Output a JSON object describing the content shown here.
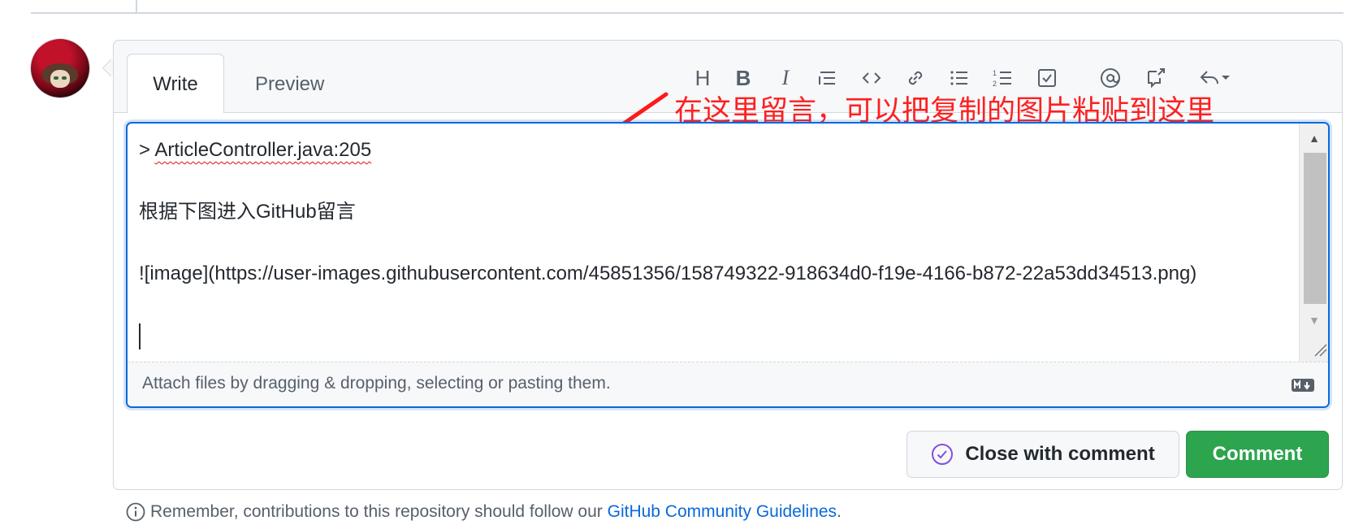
{
  "tabs": {
    "write": "Write",
    "preview": "Preview"
  },
  "toolbar": {
    "heading": "H",
    "bold": "B",
    "italic": "I"
  },
  "annotation": "在这里留言，可以把复制的图片粘贴到这里",
  "editor": {
    "lines": [
      "> ",
      "ArticleController.java:205",
      "根据下图进入GitHub留言",
      "![image](https://user-images.githubusercontent.com/45851356/158749322-918634d0-f19e-4166-b872-22a53dd34513.png)"
    ],
    "attach_hint": "Attach files by dragging & dropping, selecting or pasting them."
  },
  "buttons": {
    "close_with_comment": "Close with comment",
    "comment": "Comment"
  },
  "footer": {
    "text": "Remember, contributions to this repository should follow our ",
    "link": "GitHub Community Guidelines",
    "period": "."
  },
  "colors": {
    "accent": "#0969da",
    "comment_green": "#2da44e",
    "annotation_red": "#ff2020",
    "close_icon": "#8250df"
  }
}
